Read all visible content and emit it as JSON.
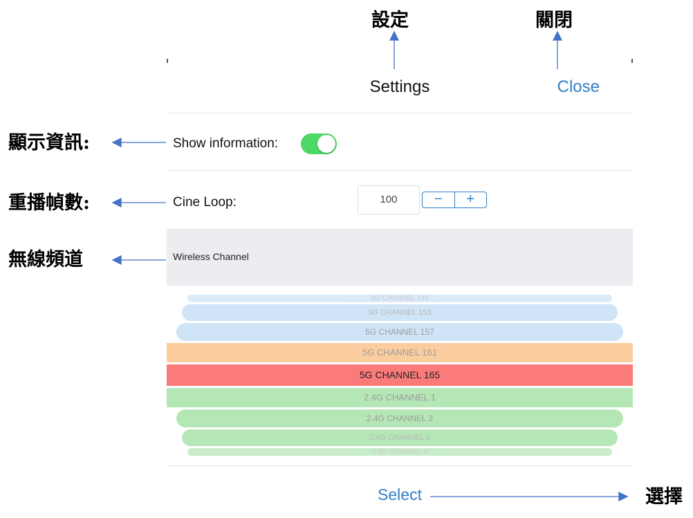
{
  "annotations": {
    "settings": "設定",
    "close": "關閉",
    "show_info": "顯示資訊:",
    "cine_loop": "重播幀數:",
    "wireless": "無線頻道",
    "select": "選擇"
  },
  "dialog": {
    "title": "Settings",
    "close_label": "Close",
    "show_info_label": "Show information:",
    "show_info_on": true,
    "cine_loop_label": "Cine Loop:",
    "cine_loop_value": "100",
    "stepper_minus": "−",
    "stepper_plus": "+",
    "wireless_label": "Wireless Channel",
    "select_label": "Select"
  },
  "picker": {
    "items": [
      "5G CHANNEL 149",
      "5G CHANNEL 153",
      "5G CHANNEL 157",
      "5G CHANNEL 161",
      "5G CHANNEL 165",
      "2.4G CHANNEL  1",
      "2.4G CHANNEL  2",
      "2.4G CHANNEL  3",
      "2.4G CHANNEL  4"
    ],
    "selected": "5G CHANNEL 165"
  },
  "colors": {
    "accent": "#2f7fc8",
    "toggle_on": "#4cd964",
    "band_5g": "#cfe4f6",
    "band_near": "#fbcd9e",
    "band_selected": "#fb7b7b",
    "band_24g": "#b5e7b6",
    "arrow": "#4472c4"
  }
}
